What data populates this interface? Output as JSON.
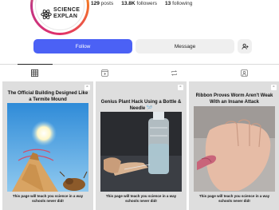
{
  "profile": {
    "brand_line1": "SCIENCE",
    "brand_line2": "EXPLAN",
    "stats": [
      {
        "value": "129",
        "label": "posts"
      },
      {
        "value": "13.8K",
        "label": "followers"
      },
      {
        "value": "13",
        "label": "following"
      }
    ]
  },
  "actions": {
    "follow_label": "Follow",
    "message_label": "Message",
    "suggest_icon": "add-person-icon"
  },
  "tabs": [
    {
      "icon": "grid-icon",
      "active": true
    },
    {
      "icon": "reels-icon",
      "active": false
    },
    {
      "icon": "reposts-icon",
      "active": false
    },
    {
      "icon": "tagged-icon",
      "active": false
    }
  ],
  "posts": [
    {
      "title": "The Official Building Designed Like a Termite Mound",
      "caption": "This page will teach you science in a way schools never did!",
      "badge_icon": "carousel-icon"
    },
    {
      "title": "Genius Plant Hack Using a Bottle & Needle 🪡",
      "caption": "This page will teach you science in a way schools never did!",
      "badge_icon": "carousel-icon"
    },
    {
      "title": "Ribbon Proves Worm Aren't Weak With an Insane Attack",
      "caption": "This page will teach you science in a way schools never did!",
      "badge_icon": "carousel-icon"
    }
  ],
  "colors": {
    "follow_button": "#4b61f5",
    "secondary_button": "#efefef",
    "post_background": "#dedede"
  }
}
